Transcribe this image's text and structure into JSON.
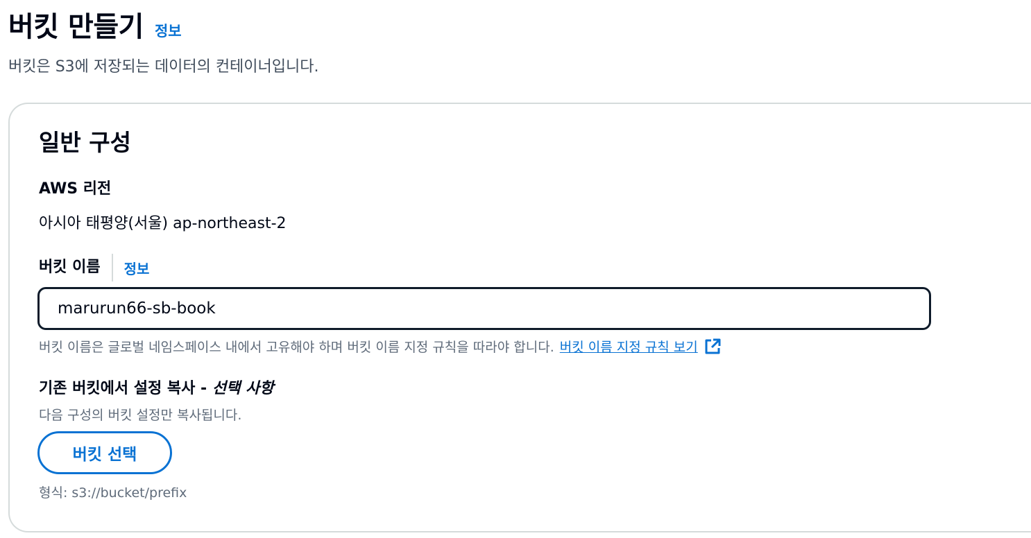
{
  "header": {
    "title": "버킷 만들기",
    "info_link": "정보",
    "description": "버킷은 S3에 저장되는 데이터의 컨테이너입니다."
  },
  "general_config": {
    "title": "일반 구성",
    "region": {
      "label": "AWS 리전",
      "value": "아시아 태평양(서울) ap-northeast-2"
    },
    "bucket_name": {
      "label": "버킷 이름",
      "info_link": "정보",
      "value": "marurun66-sb-book",
      "constraint": "버킷 이름은 글로벌 네임스페이스 내에서 고유해야 하며 버킷 이름 지정 규칙을 따라야 합니다.",
      "rules_link": "버킷 이름 지정 규칙 보기"
    },
    "copy_settings": {
      "label": "기존 버킷에서 설정 복사 - ",
      "optional": "선택 사항",
      "description": "다음 구성의 버킷 설정만 복사됩니다.",
      "button": "버킷 선택",
      "format_hint": "형식: s3://bucket/prefix"
    }
  },
  "colors": {
    "link": "#0972d3",
    "text": "#000716",
    "secondary_text": "#5f6b7a",
    "border": "#d5dbdb",
    "input_border": "#0f1b2a"
  },
  "icons": {
    "external_link": "external-link-icon"
  }
}
